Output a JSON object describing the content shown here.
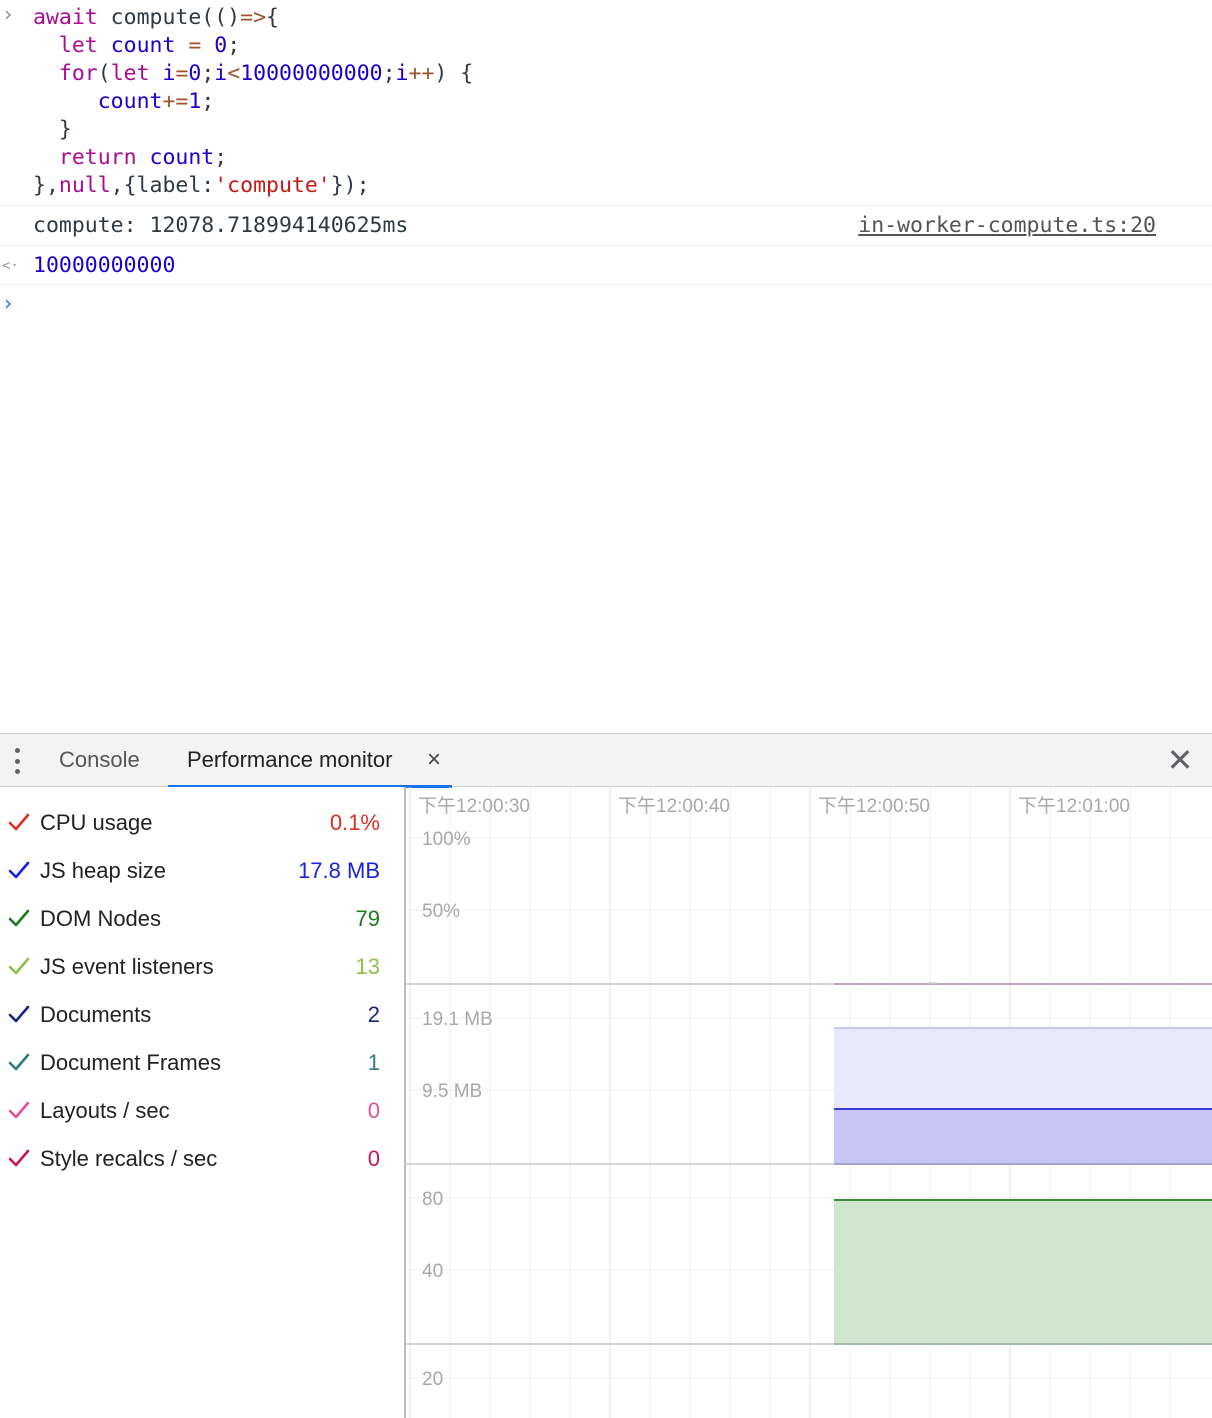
{
  "console": {
    "result_value": "10000000000",
    "log": {
      "text": "compute: 12078.718994140625ms",
      "source_link": "in-worker-compute.ts:20"
    }
  },
  "drawer": {
    "tabs": [
      {
        "label": "Console"
      },
      {
        "label": "Performance monitor"
      }
    ],
    "tab_close_symbol": "×",
    "drawer_close_symbol": "✕",
    "kebab_icon": "more-vertical-icon"
  },
  "metrics": [
    {
      "label": "CPU usage",
      "value": "0.1%",
      "color": "#d93025"
    },
    {
      "label": "JS heap size",
      "value": "17.8 MB",
      "color": "#1a22d9"
    },
    {
      "label": "DOM Nodes",
      "value": "79",
      "color": "#1e7a1e"
    },
    {
      "label": "JS event listeners",
      "value": "13",
      "color": "#8bc34a"
    },
    {
      "label": "Documents",
      "value": "2",
      "color": "#1a237e"
    },
    {
      "label": "Document Frames",
      "value": "1",
      "color": "#2e7d7d"
    },
    {
      "label": "Layouts / sec",
      "value": "0",
      "color": "#e0519a"
    },
    {
      "label": "Style recalcs / sec",
      "value": "0",
      "color": "#c2185b"
    }
  ],
  "graph": {
    "time_labels": [
      "下午12:00:30",
      "下午12:00:40",
      "下午12:00:50",
      "下午12:01:00"
    ],
    "cpu_scale": [
      "100%",
      "50%"
    ],
    "heap_scale": [
      "19.1 MB",
      "9.5 MB"
    ],
    "dom_scale": [
      "80",
      "40"
    ],
    "listeners_scale": [
      "20"
    ],
    "series_colors": {
      "cpu": "#9c3aa8",
      "heap_line": "#3b3bd9",
      "heap_fill_light": "#e8e8fb",
      "heap_fill_dark": "#c6c6f5",
      "dom_line": "#3d8b3d",
      "dom_fill": "#d0e6cf"
    }
  }
}
